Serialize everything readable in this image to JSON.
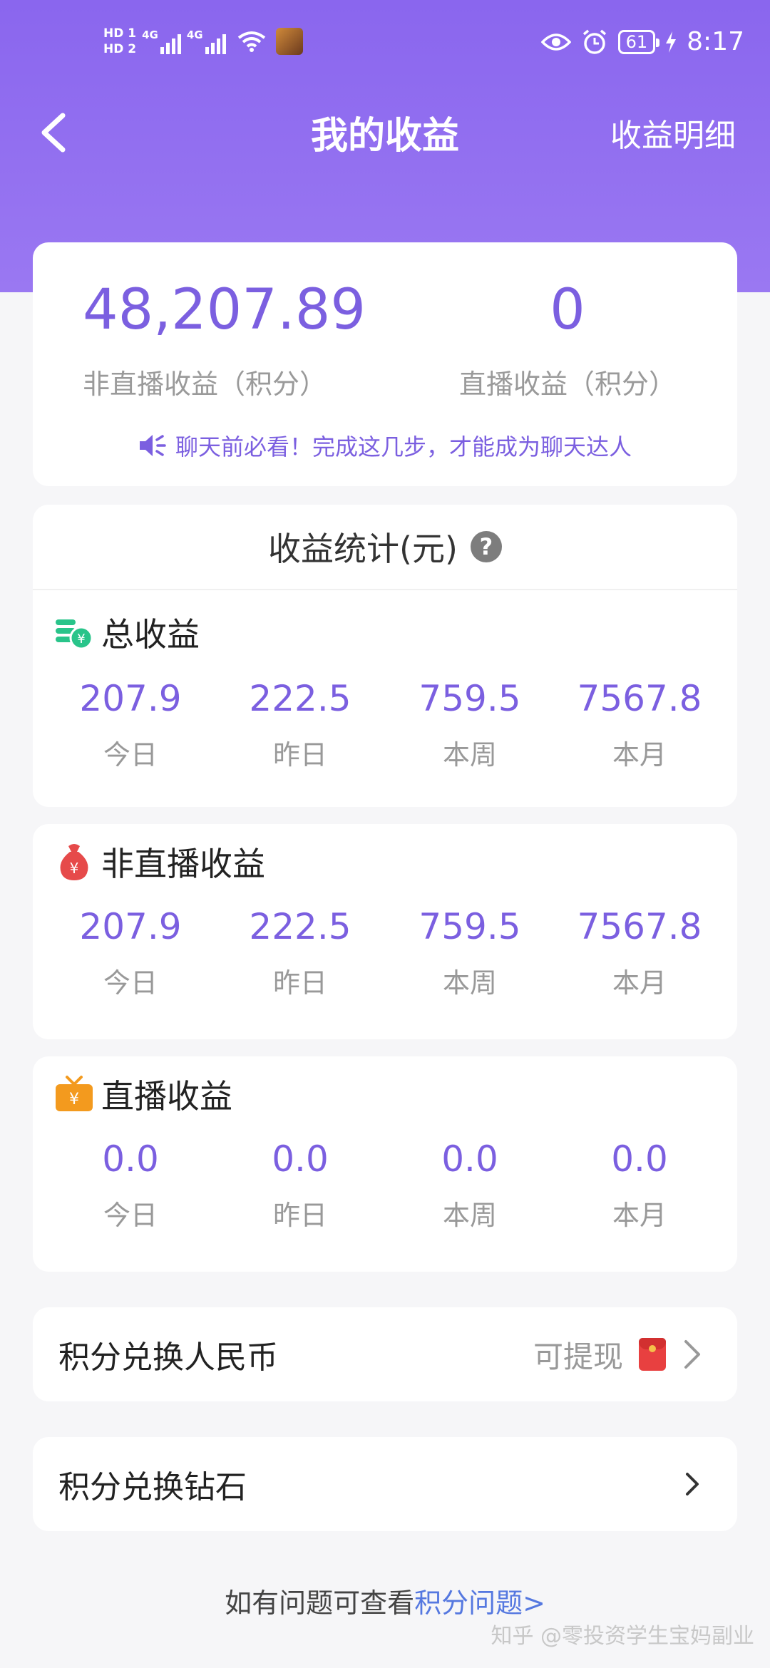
{
  "status_bar": {
    "hd1": "HD 1",
    "hd2": "HD 2",
    "net1": "4G",
    "net2": "4G",
    "battery": "61",
    "time": "8:17"
  },
  "nav": {
    "title": "我的收益",
    "right_link": "收益明细"
  },
  "summary": {
    "non_live_value": "48,207.89",
    "non_live_label": "非直播收益（积分）",
    "live_value": "0",
    "live_label": "直播收益（积分）",
    "notice": "聊天前必看！完成这几步，才能成为聊天达人"
  },
  "stats": {
    "title": "收益统计(元)",
    "help": "?",
    "sections": [
      {
        "name": "总收益",
        "items": [
          {
            "value": "207.9",
            "label": "今日"
          },
          {
            "value": "222.5",
            "label": "昨日"
          },
          {
            "value": "759.5",
            "label": "本周"
          },
          {
            "value": "7567.8",
            "label": "本月"
          }
        ]
      },
      {
        "name": "非直播收益",
        "items": [
          {
            "value": "207.9",
            "label": "今日"
          },
          {
            "value": "222.5",
            "label": "昨日"
          },
          {
            "value": "759.5",
            "label": "本周"
          },
          {
            "value": "7567.8",
            "label": "本月"
          }
        ]
      },
      {
        "name": "直播收益",
        "items": [
          {
            "value": "0.0",
            "label": "今日"
          },
          {
            "value": "0.0",
            "label": "昨日"
          },
          {
            "value": "0.0",
            "label": "本周"
          },
          {
            "value": "0.0",
            "label": "本月"
          }
        ]
      }
    ]
  },
  "exchange": {
    "rmb_title": "积分兑换人民币",
    "rmb_sub": "可提现",
    "diamond_title": "积分兑换钻石"
  },
  "footer": {
    "text": "如有问题可查看",
    "link": "积分问题>"
  },
  "watermark": "知乎 @零投资学生宝妈副业",
  "colors": {
    "accent": "#7b5fe0",
    "header": "#8a66ee",
    "link": "#5578e0"
  }
}
